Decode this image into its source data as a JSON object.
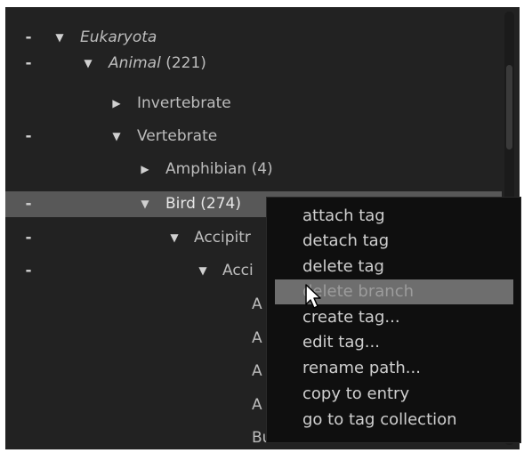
{
  "tree": {
    "rows": [
      {
        "dash": "-",
        "arrow": "▼",
        "label": "Eukaryota",
        "count": ""
      },
      {
        "dash": "-",
        "arrow": "▼",
        "label": "Animal",
        "count": " (221)"
      },
      {
        "dash": "",
        "arrow": "▶",
        "label": "Invertebrate",
        "count": ""
      },
      {
        "dash": "-",
        "arrow": "▼",
        "label": "Vertebrate",
        "count": ""
      },
      {
        "dash": "",
        "arrow": "▶",
        "label": "Amphibian",
        "count": " (4)"
      },
      {
        "dash": "-",
        "arrow": "▼",
        "label": "Bird",
        "count": " (274)"
      },
      {
        "dash": "-",
        "arrow": "▼",
        "label": "Accipitr",
        "count": ""
      },
      {
        "dash": "-",
        "arrow": "▼",
        "label": "Acci",
        "count": ""
      },
      {
        "dash": "",
        "arrow": "",
        "label": "A",
        "count": ""
      },
      {
        "dash": "",
        "arrow": "",
        "label": "A",
        "count": ""
      },
      {
        "dash": "",
        "arrow": "",
        "label": "A",
        "count": ""
      },
      {
        "dash": "",
        "arrow": "",
        "label": "A",
        "count": ""
      },
      {
        "dash": "",
        "arrow": "",
        "label": "Bu",
        "count": ""
      }
    ]
  },
  "context_menu": {
    "items": [
      "attach tag",
      "detach tag",
      "delete tag",
      "delete branch",
      "create tag...",
      "edit tag...",
      "rename path...",
      "copy to entry",
      "go to tag collection"
    ],
    "hovered_item": "delete branch"
  },
  "colors": {
    "panel_bg": "#222222",
    "selected_row": "#585858",
    "menu_bg": "#0f0f0f",
    "menu_hover": "#6e6e6e"
  }
}
